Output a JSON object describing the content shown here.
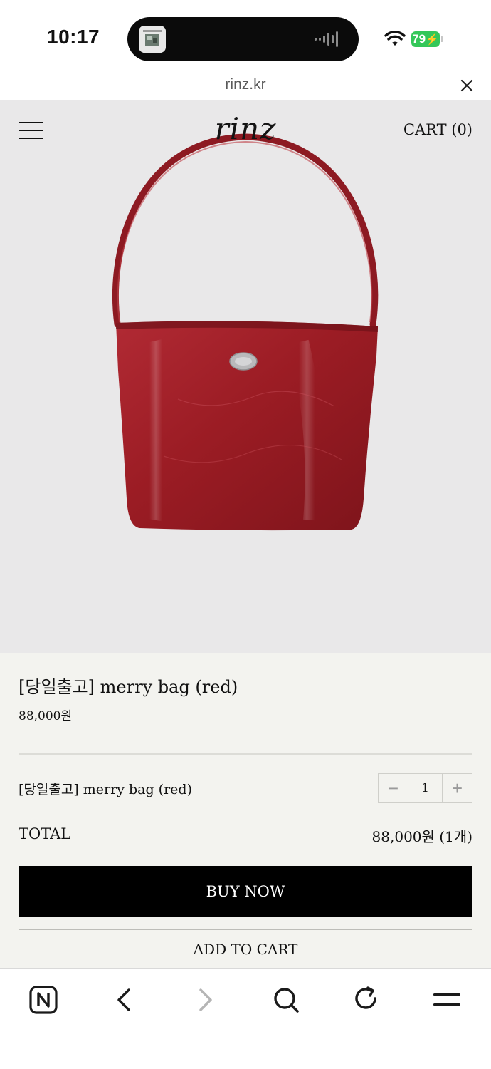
{
  "status_bar": {
    "time": "10:17",
    "battery": "79",
    "battery_color": "#34c759"
  },
  "browser": {
    "url": "rinz.kr",
    "close_icon": "close-icon"
  },
  "site_header": {
    "logo": "rinz",
    "cart_label": "CART (0)",
    "menu_icon": "hamburger-menu-icon"
  },
  "product": {
    "image_alt": "red leather shoulder bag",
    "title": "[당일출고] merry bag (red)",
    "price": "88,000원"
  },
  "option": {
    "name": "[당일출고] merry bag (red)",
    "decrement_label": "−",
    "quantity": "1",
    "increment_label": "+"
  },
  "total": {
    "label": "TOTAL",
    "value": "88,000원 (1개)"
  },
  "actions": {
    "buy_now": "BUY NOW",
    "add_to_cart": "ADD TO CART"
  },
  "toolbar": {
    "icons": [
      "naver-home-icon",
      "back-icon",
      "forward-icon",
      "search-icon",
      "reload-icon",
      "menu-icon"
    ]
  },
  "colors": {
    "bag_red": "#9b1c24",
    "hero_background": "#e9e8e9",
    "info_background": "#f3f3ef",
    "button_black": "#000000"
  }
}
